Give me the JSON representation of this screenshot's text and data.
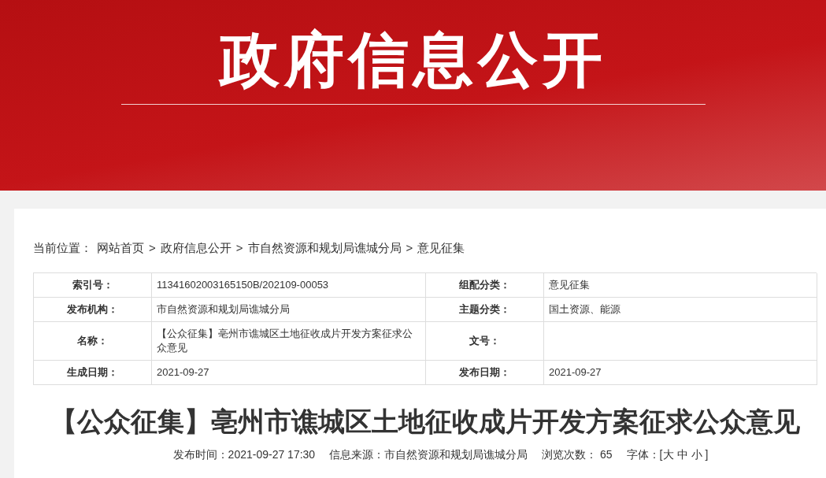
{
  "banner": {
    "title": "政府信息公开"
  },
  "breadcrumb": {
    "label": "当前位置：",
    "items": [
      "网站首页",
      "政府信息公开",
      "市自然资源和规划局谯城分局",
      "意见征集"
    ],
    "separator": ">"
  },
  "info_table": {
    "rows": [
      [
        {
          "label": "索引号：",
          "value": "11341602003165150B/202109-00053"
        },
        {
          "label": "组配分类：",
          "value": "意见征集"
        }
      ],
      [
        {
          "label": "发布机构：",
          "value": "市自然资源和规划局谯城分局"
        },
        {
          "label": "主题分类：",
          "value": "国土资源、能源"
        }
      ],
      [
        {
          "label": "名称：",
          "value": "【公众征集】亳州市谯城区土地征收成片开发方案征求公众意见"
        },
        {
          "label": "文号："
        }
      ],
      [
        {
          "label": "生成日期：",
          "value": "2021-09-27"
        },
        {
          "label": "发布日期：",
          "value": "2021-09-27"
        }
      ]
    ]
  },
  "article": {
    "title": "【公众征集】亳州市谯城区土地征收成片开发方案征求公众意见",
    "meta": [
      "发布时间：2021-09-27 17:30",
      "信息来源：市自然资源和规划局谯城分局",
      "浏览次数： 65"
    ],
    "font_size": {
      "label": "字体：[",
      "options": [
        "大",
        "中",
        "小"
      ],
      "close": "]"
    }
  }
}
